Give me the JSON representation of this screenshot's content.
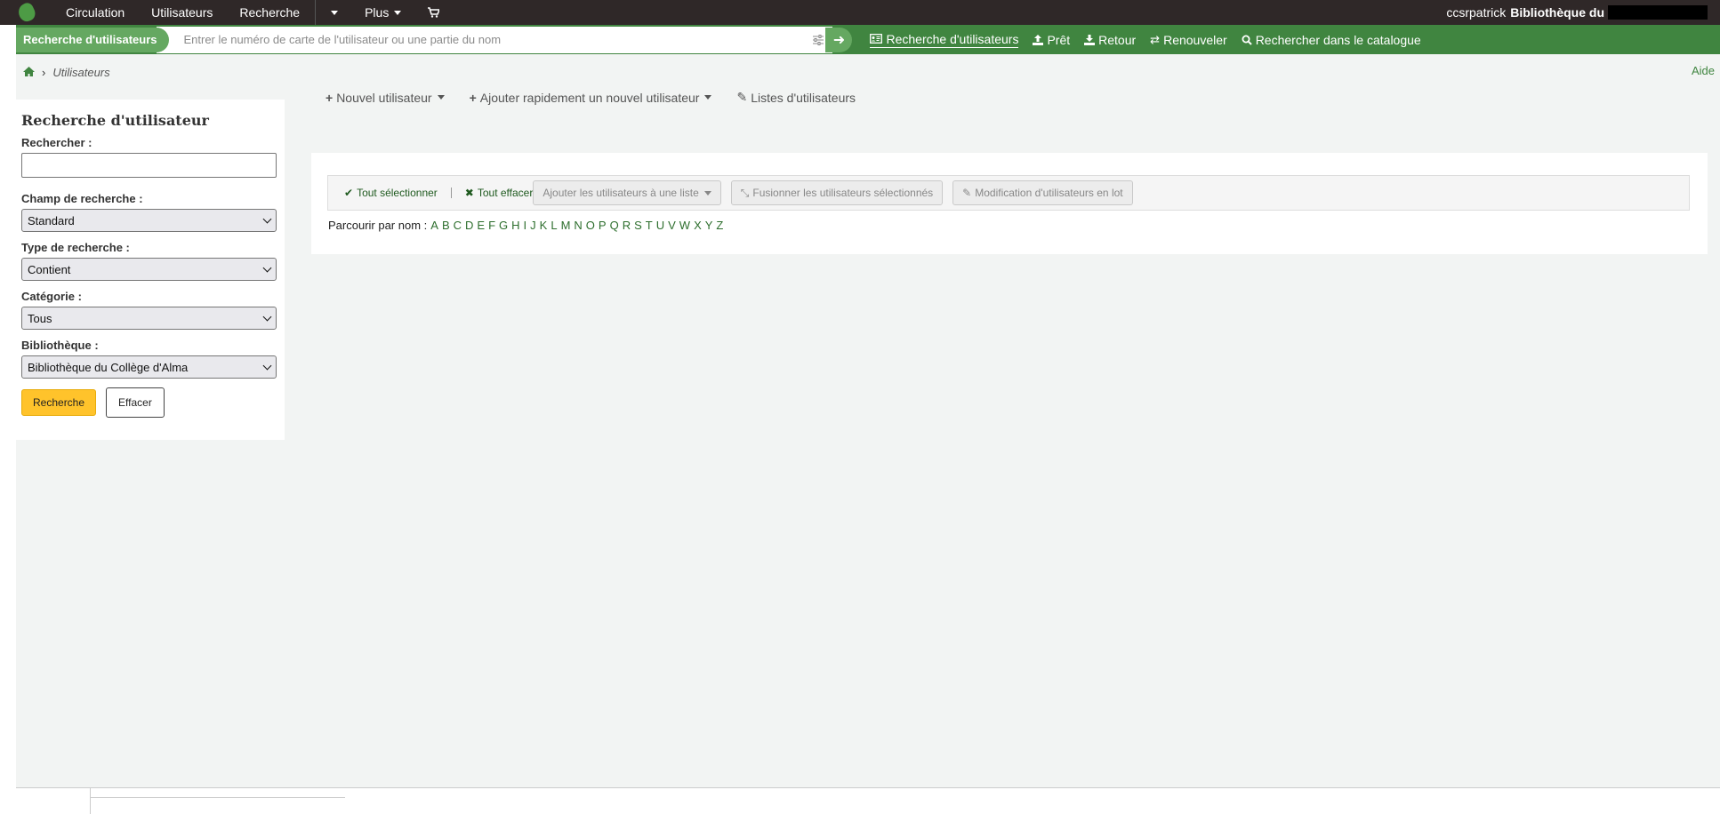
{
  "topnav": {
    "items": [
      {
        "label": "Circulation"
      },
      {
        "label": "Utilisateurs"
      },
      {
        "label": "Recherche"
      }
    ],
    "plus_label": "Plus",
    "user": "ccsrpatrick",
    "library": "Bibliothèque du"
  },
  "header": {
    "tab_label": "Recherche d'utilisateurs",
    "search_placeholder": "Entrer le numéro de carte de l'utilisateur ou une partie du nom",
    "links": [
      {
        "label": "Recherche d'utilisateurs",
        "icon": "id-card-icon"
      },
      {
        "label": "Prêt",
        "icon": "upload-icon"
      },
      {
        "label": "Retour",
        "icon": "download-icon"
      },
      {
        "label": "Renouveler",
        "icon": "retweet-icon"
      },
      {
        "label": "Rechercher dans le catalogue",
        "icon": "search-icon"
      }
    ]
  },
  "breadcrumb": {
    "current": "Utilisateurs"
  },
  "help_label": "Aide",
  "sidebar": {
    "title": "Recherche d'utilisateur",
    "search_label": "Rechercher :",
    "search_value": "",
    "field_label": "Champ de recherche :",
    "field_value": "Standard",
    "type_label": "Type de recherche :",
    "type_value": "Contient",
    "category_label": "Catégorie :",
    "category_value": "Tous",
    "library_label": "Bibliothèque :",
    "library_value": "Bibliothèque du Collège d'Alma",
    "submit_label": "Recherche",
    "clear_label": "Effacer"
  },
  "toolbar": {
    "new_patron": "Nouvel utilisateur",
    "quick_add": "Ajouter rapidement un nouvel utilisateur",
    "lists": "Listes d'utilisateurs"
  },
  "actions": {
    "select_all": "Tout sélectionner",
    "clear_all": "Tout effacer",
    "add_to_list": "Ajouter les utilisateurs à une liste",
    "merge": "Fusionner les utilisateurs sélectionnés",
    "batch_modify": "Modification d'utilisateurs en lot"
  },
  "browse": {
    "label": "Parcourir par nom :",
    "letters": [
      "A",
      "B",
      "C",
      "D",
      "E",
      "F",
      "G",
      "H",
      "I",
      "J",
      "K",
      "L",
      "M",
      "N",
      "O",
      "P",
      "Q",
      "R",
      "S",
      "T",
      "U",
      "V",
      "W",
      "X",
      "Y",
      "Z"
    ]
  },
  "colors": {
    "topbar": "#2f2828",
    "green": "#408540",
    "accent": "#ffc32b"
  }
}
